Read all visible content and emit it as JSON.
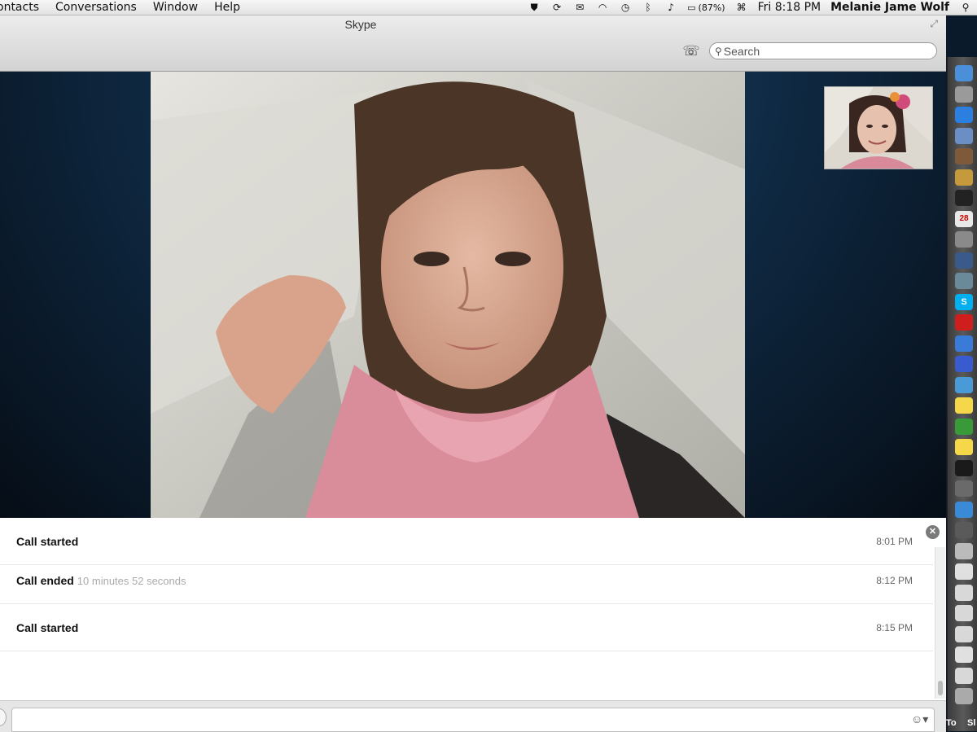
{
  "menubar": {
    "items": [
      "ontacts",
      "Conversations",
      "Window",
      "Help"
    ],
    "battery": "(87%)",
    "clock": "Fri 8:18 PM",
    "user": "Melanie Jame Wolf"
  },
  "window": {
    "title": "Skype",
    "search_placeholder": "Search"
  },
  "chat": {
    "rows": [
      {
        "label": "Call started",
        "detail": "",
        "time": "8:01 PM"
      },
      {
        "label": "Call ended",
        "detail": "10 minutes 52 seconds",
        "time": "8:12 PM"
      },
      {
        "label": "Call started",
        "detail": "",
        "time": "8:15 PM"
      }
    ]
  },
  "dock": {
    "items": [
      {
        "icon": "finder-icon",
        "color": "#4a8fd8"
      },
      {
        "icon": "launchpad-icon",
        "color": "#9a9a9a"
      },
      {
        "icon": "app-store-icon",
        "color": "#2a7fe0"
      },
      {
        "icon": "preview-icon",
        "color": "#6b8fc4"
      },
      {
        "icon": "photo-booth-icon",
        "color": "#7f5a3a"
      },
      {
        "icon": "notes-icon",
        "color": "#c49a3c"
      },
      {
        "icon": "console-icon",
        "color": "#222222"
      },
      {
        "icon": "calendar-icon",
        "color": "#e8e8e8",
        "text": "28"
      },
      {
        "icon": "system-preferences-icon",
        "color": "#8a8a8a"
      },
      {
        "icon": "final-cut-icon",
        "color": "#3a5a8a"
      },
      {
        "icon": "network-icon",
        "color": "#6a8a9a"
      },
      {
        "icon": "skype-icon",
        "color": "#00aff0",
        "text": "S"
      },
      {
        "icon": "acrobat-icon",
        "color": "#d01e1e"
      },
      {
        "icon": "itunes-icon",
        "color": "#3a7ad8"
      },
      {
        "icon": "pencil-app-icon",
        "color": "#3a5ad0"
      },
      {
        "icon": "dropbox-sync-icon",
        "color": "#4a9ad8"
      },
      {
        "icon": "stickies-icon",
        "color": "#f4d84a"
      },
      {
        "icon": "chrome-icon",
        "color": "#3a9a3a"
      },
      {
        "icon": "stickies-icon",
        "color": "#f4d84a"
      },
      {
        "icon": "terminal-icon",
        "color": "#1a1a1a"
      },
      {
        "icon": "image-capture-icon",
        "color": "#6a6a6a"
      },
      {
        "icon": "safari-icon",
        "color": "#3a8ad8"
      },
      {
        "icon": "separator-icon",
        "color": "#5a5a5a"
      },
      {
        "icon": "download-icon",
        "color": "#bbbbbb"
      },
      {
        "icon": "pdf-document-icon",
        "color": "#e0e0e0"
      },
      {
        "icon": "document-icon",
        "color": "#d8d8d8"
      },
      {
        "icon": "document-icon",
        "color": "#d8d8d8"
      },
      {
        "icon": "document-icon",
        "color": "#d8d8d8"
      },
      {
        "icon": "pdf-document-icon",
        "color": "#e0e0e0"
      },
      {
        "icon": "document-icon",
        "color": "#d8d8d8"
      },
      {
        "icon": "trash-icon",
        "color": "#aaaaaa"
      }
    ],
    "bottom_labels": [
      "To",
      "Sl"
    ]
  }
}
